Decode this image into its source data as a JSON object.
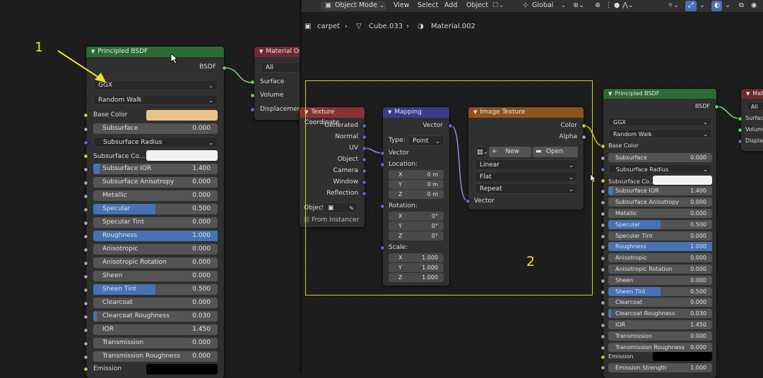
{
  "header": {
    "mode": "Object Mode",
    "menu": [
      "View",
      "Select",
      "Add",
      "Object"
    ],
    "orientation": "Global"
  },
  "breadcrumb": {
    "object": "carpet",
    "mesh": "Cube.033",
    "material": "Material.002"
  },
  "annotations": {
    "one": "1",
    "two": "2"
  },
  "colors": {
    "shader_header": "#2d6b35",
    "output_header": "#6e2a31",
    "input_header": "#8a3134",
    "vector_header": "#3b3a8c",
    "texture_header": "#8f531f",
    "selection": "#d9d22a",
    "accent": "#4772b3",
    "base_color": "#e8c38e"
  },
  "bsdf_left": {
    "title": "Principled BSDF",
    "output": "BSDF",
    "distribution": "GGX",
    "subsurface_method": "Random Walk",
    "base_color": "Base Color",
    "rows": [
      {
        "label": "Subsurface",
        "value": "0.000",
        "fill": 0
      },
      {
        "label": "Subsurface Radius",
        "type": "dropdown"
      },
      {
        "label": "Subsurface Co...",
        "type": "color"
      },
      {
        "label": "Subsurface IOR",
        "value": "1.400",
        "fill": 0.05
      },
      {
        "label": "Subsurface Anisotropy",
        "value": "0.000",
        "fill": 0
      },
      {
        "label": "Metallic",
        "value": "0.000",
        "fill": 0
      },
      {
        "label": "Specular",
        "value": "0.500",
        "fill": 0.5
      },
      {
        "label": "Specular Tint",
        "value": "0.000",
        "fill": 0
      },
      {
        "label": "Roughness",
        "value": "1.000",
        "fill": 1
      },
      {
        "label": "Anisotropic",
        "value": "0.000",
        "fill": 0
      },
      {
        "label": "Anisotropic Rotation",
        "value": "0.000",
        "fill": 0
      },
      {
        "label": "Sheen",
        "value": "0.000",
        "fill": 0
      },
      {
        "label": "Sheen Tint",
        "value": "0.500",
        "fill": 0.5
      },
      {
        "label": "Clearcoat",
        "value": "0.000",
        "fill": 0
      },
      {
        "label": "Clearcoat Roughness",
        "value": "0.030",
        "fill": 0.03
      },
      {
        "label": "IOR",
        "value": "1.450",
        "fill": 0
      },
      {
        "label": "Transmission",
        "value": "0.000",
        "fill": 0
      },
      {
        "label": "Transmission Roughness",
        "value": "0.000",
        "fill": 0
      }
    ],
    "emission": "Emission"
  },
  "output_left": {
    "title": "Material Ou",
    "target": "All",
    "inputs": [
      "Surface",
      "Volume",
      "Displacement"
    ]
  },
  "tex_coord": {
    "title": "Texture Coordinate",
    "outputs": [
      "Generated",
      "Normal",
      "UV",
      "Object",
      "Camera",
      "Window",
      "Reflection"
    ],
    "object_label": "Object:",
    "instancer": "From Instancer"
  },
  "mapping": {
    "title": "Mapping",
    "output": "Vector",
    "type_label": "Type:",
    "type_value": "Point",
    "vector": "Vector",
    "location_label": "Location:",
    "location": [
      {
        "axis": "X",
        "value": "0 m"
      },
      {
        "axis": "Y",
        "value": "0 m"
      },
      {
        "axis": "Z",
        "value": "0 m"
      }
    ],
    "rotation_label": "Rotation:",
    "rotation": [
      {
        "axis": "X",
        "value": "0°"
      },
      {
        "axis": "Y",
        "value": "0°"
      },
      {
        "axis": "Z",
        "value": "0°"
      }
    ],
    "scale_label": "Scale:",
    "scale": [
      {
        "axis": "X",
        "value": "1.000"
      },
      {
        "axis": "Y",
        "value": "1.000"
      },
      {
        "axis": "Z",
        "value": "1.000"
      }
    ]
  },
  "image_texture": {
    "title": "Image Texture",
    "outputs": [
      "Color",
      "Alpha"
    ],
    "new": "New",
    "open": "Open",
    "interpolation": "Linear",
    "projection": "Flat",
    "extension": "Repeat",
    "input": "Vector"
  },
  "bsdf_right": {
    "title": "Principled BSDF",
    "output": "BSDF",
    "distribution": "GGX",
    "subsurface_method": "Random Walk",
    "base_color": "Base Color",
    "rows": [
      {
        "label": "Subsurface",
        "value": "0.000",
        "fill": 0
      },
      {
        "label": "Subsurface Radius",
        "type": "dropdown"
      },
      {
        "label": "Subsurface Co...",
        "type": "color"
      },
      {
        "label": "Subsurface IOR",
        "value": "1.400",
        "fill": 0.05
      },
      {
        "label": "Subsurface Anisotropy",
        "value": "0.000",
        "fill": 0
      },
      {
        "label": "Metallic",
        "value": "0.000",
        "fill": 0
      },
      {
        "label": "Specular",
        "value": "0.500",
        "fill": 0.5
      },
      {
        "label": "Specular Tint",
        "value": "0.000",
        "fill": 0
      },
      {
        "label": "Roughness",
        "value": "1.000",
        "fill": 1
      },
      {
        "label": "Anisotropic",
        "value": "0.000",
        "fill": 0
      },
      {
        "label": "Anisotropic Rotation",
        "value": "0.000",
        "fill": 0
      },
      {
        "label": "Sheen",
        "value": "0.000",
        "fill": 0
      },
      {
        "label": "Sheen Tint",
        "value": "0.500",
        "fill": 0.5
      },
      {
        "label": "Clearcoat",
        "value": "0.000",
        "fill": 0
      },
      {
        "label": "Clearcoat Roughness",
        "value": "0.030",
        "fill": 0.03
      },
      {
        "label": "IOR",
        "value": "1.450",
        "fill": 0
      },
      {
        "label": "Transmission",
        "value": "0.000",
        "fill": 0
      },
      {
        "label": "Transmission Roughness",
        "value": "0.000",
        "fill": 0
      }
    ],
    "emission": "Emission",
    "emission_strength_label": "Emission Strength",
    "emission_strength": "1.000"
  },
  "output_right": {
    "title": "Mat",
    "target": "All",
    "inputs": [
      "Surface",
      "Volume",
      "Displac"
    ]
  }
}
